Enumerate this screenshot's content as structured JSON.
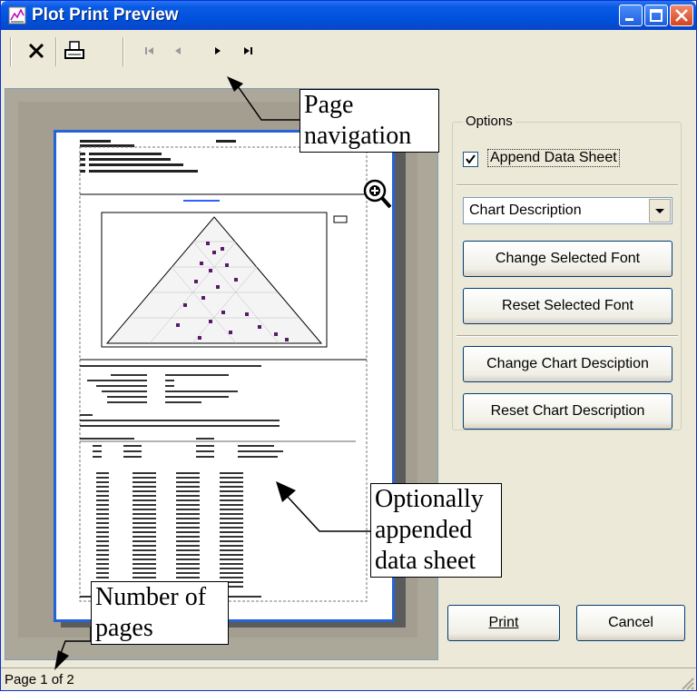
{
  "window": {
    "title": "Plot Print Preview",
    "accent": "#0052dd"
  },
  "toolbar": {
    "icons": [
      "close-icon",
      "print-icon",
      "first-page-icon",
      "previous-page-icon",
      "next-page-icon",
      "last-page-icon"
    ]
  },
  "options": {
    "group_label": "Options",
    "append_data_sheet": {
      "label": "Append Data Sheet",
      "checked": true
    },
    "font_target": {
      "selected": "Chart Description"
    },
    "change_font_label": "Change Selected Font",
    "reset_font_label": "Reset Selected Font",
    "change_desc_label": "Change Chart Desciption",
    "reset_desc_label": "Reset Chart Description"
  },
  "actions": {
    "print_label": "Print",
    "cancel_label": "Cancel"
  },
  "status": {
    "page_info": "Page 1 of 2"
  },
  "annotations": {
    "page_navigation": [
      "Page",
      "navigation"
    ],
    "data_sheet": [
      "Optionally",
      "appended",
      "data sheet"
    ],
    "pages": [
      "Number of",
      "pages"
    ]
  }
}
